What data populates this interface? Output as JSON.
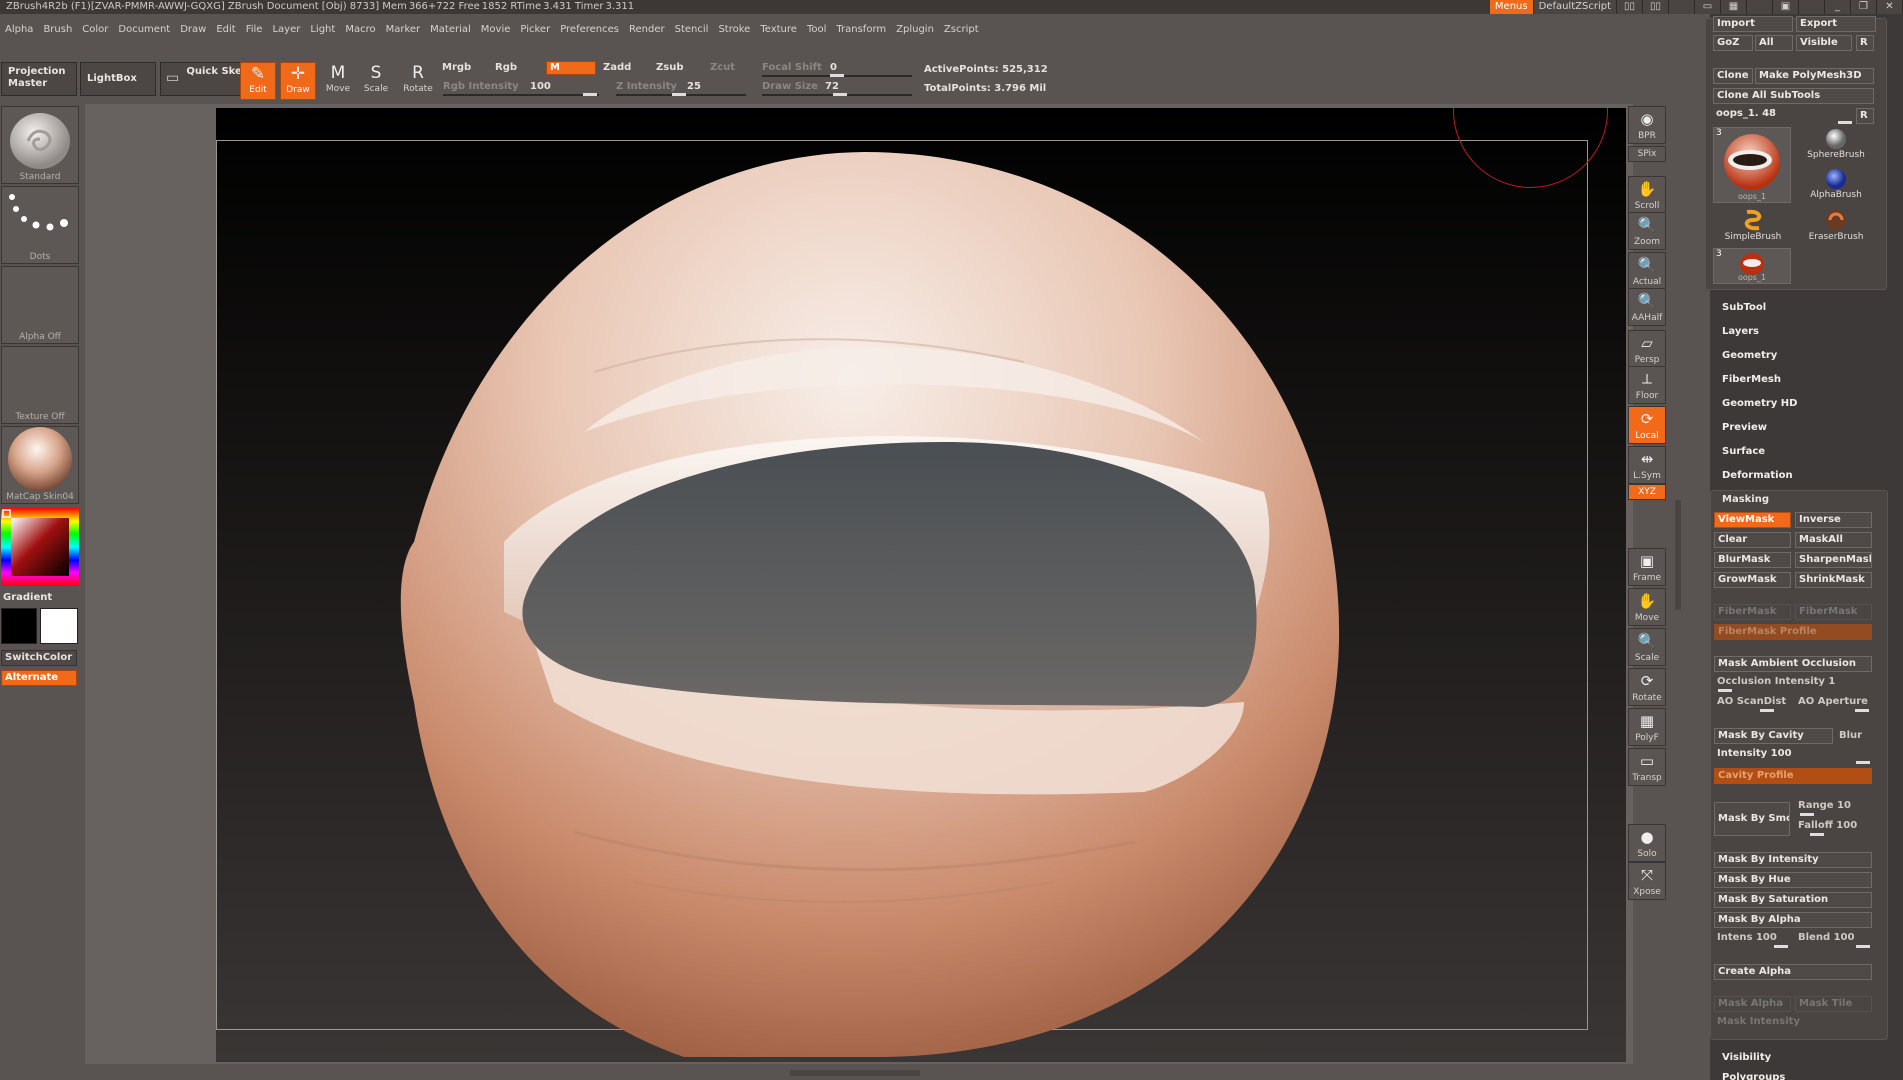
{
  "titlebar": {
    "title": "ZBrush4R2b  (F1)[ZVAR-PMMR-AWWJ-GQXG]     ZBrush Document     [Obj) 8733] Mem 366+722  Free 1852  RTime 3.431  Timer 3.311",
    "menus_btn": "Menus",
    "script_btn": "DefaultZScript"
  },
  "menubar": [
    "Alpha",
    "Brush",
    "Color",
    "Document",
    "Draw",
    "Edit",
    "File",
    "Layer",
    "Light",
    "Macro",
    "Marker",
    "Material",
    "Movie",
    "Picker",
    "Preferences",
    "Render",
    "Stencil",
    "Stroke",
    "Texture",
    "Tool",
    "Transform",
    "Zplugin",
    "Zscript"
  ],
  "toolbar": {
    "projection_master": "Projection Master",
    "lightbox": "LightBox",
    "quick_sketch": "Quick Sketch",
    "edit": "Edit",
    "draw": "Draw",
    "move": "Move",
    "scale": "Scale",
    "rotate": "Rotate",
    "mrgb": "Mrgb",
    "rgb": "Rgb",
    "m": "M",
    "zadd": "Zadd",
    "zsub": "Zsub",
    "zcut": "Zcut",
    "rgb_intensity_label": "Rgb  Intensity",
    "rgb_intensity_value": "100",
    "z_intensity_label": "Z  Intensity",
    "z_intensity_value": "25",
    "focal_shift_label": "Focal  Shift",
    "focal_shift_value": "0",
    "draw_size_label": "Draw  Size",
    "draw_size_value": "72",
    "active_points": "ActivePoints: 525,312",
    "total_points": "TotalPoints: 3.796  Mil"
  },
  "leftbar": {
    "standard": "Standard",
    "dots": "Dots",
    "alpha_off": "Alpha  Off",
    "texture_off": "Texture  Off",
    "matcap": "MatCap  Skin04",
    "gradient": "Gradient",
    "switchcolor": "SwitchColor",
    "alternate": "Alternate"
  },
  "rightdock": [
    "BPR",
    "SPix",
    "Scroll",
    "Zoom",
    "Actual",
    "AAHalf",
    "Persp",
    "Floor",
    "Local",
    "L.Sym",
    "XYZ",
    "Frame",
    "Move",
    "Scale",
    "Rotate",
    "PolyF",
    "Transp",
    "Solo",
    "Xpose"
  ],
  "panel": {
    "import": "Import",
    "export": "Export",
    "goz": "GoZ",
    "all": "All",
    "visible": "Visible",
    "r": "R",
    "clone": "Clone",
    "make_polymesh": "Make PolyMesh3D",
    "clone_all": "Clone  All  SubTools",
    "oops_label": "oops_1. 48",
    "tools": [
      "oops_1",
      "SphereBrush",
      "AlphaBrush",
      "SimpleBrush",
      "EraserBrush",
      "oops_1"
    ],
    "tool_count": "3",
    "sections": [
      "SubTool",
      "Layers",
      "Geometry",
      "FiberMesh",
      "Geometry  HD",
      "Preview",
      "Surface",
      "Deformation"
    ],
    "masking": {
      "title": "Masking",
      "viewmask": "ViewMask",
      "inverse": "Inverse",
      "clear": "Clear",
      "maskall": "MaskAll",
      "blurmask": "BlurMask",
      "sharpenmask": "SharpenMask",
      "growmask": "GrowMask",
      "shrinkmask": "ShrinkMask",
      "fibermask": "FiberMask",
      "fibermask2": "FiberMask",
      "fibermask_profile": "FiberMask  Profile",
      "mask_ao": "Mask  Ambient  Occlusion",
      "occlusion_intensity": "Occlusion  Intensity 1",
      "ao_scandist": "AO  ScanDist",
      "ao_aperture": "AO  Aperture",
      "mask_by_cavity": "Mask  By  Cavity",
      "blur": "Blur",
      "intensity": "Intensity 100",
      "cavity_profile": "Cavity  Profile",
      "mask_by_smoothness": "Mask  By  Smoothness",
      "range": "Range 10",
      "falloff": "Falloff 100",
      "mask_by_intensity": "Mask  By  Intensity",
      "mask_by_hue": "Mask  By  Hue",
      "mask_by_saturation": "Mask  By  Saturation",
      "mask_by_alpha": "Mask  By  Alpha",
      "intens": "Intens 100",
      "blend": "Blend 100",
      "create_alpha": "Create  Alpha",
      "mask_alpha": "Mask  Alpha",
      "mask_tile": "Mask  Tile",
      "mask_intensity": "Mask  Intensity"
    },
    "visibility": "Visibility",
    "polygroups": "Polygroups"
  },
  "colors": {
    "accent": "#f06a1a",
    "background": "#595351",
    "panel": "#3d3938"
  }
}
